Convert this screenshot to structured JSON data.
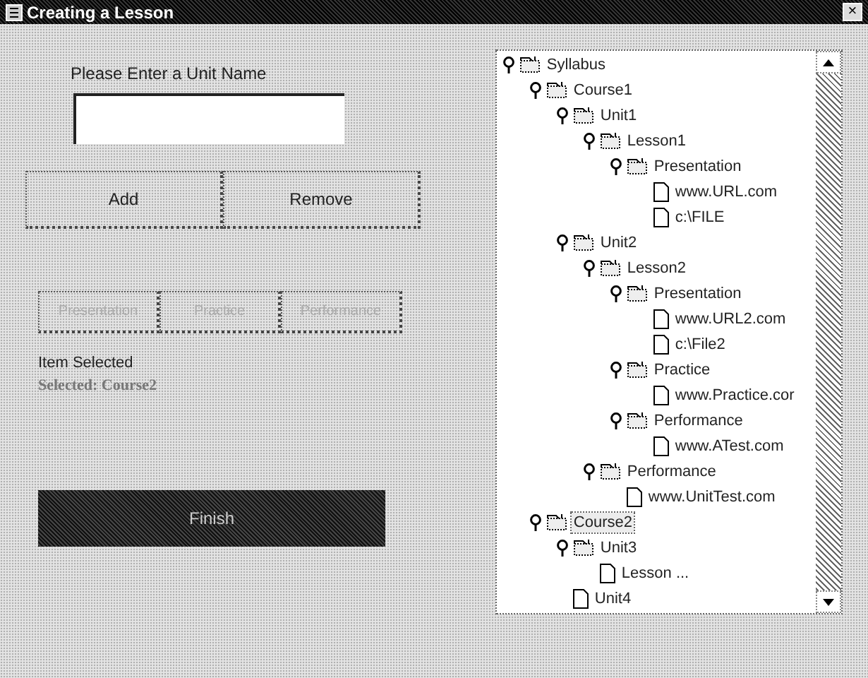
{
  "window": {
    "title": "Creating a Lesson",
    "close": "×"
  },
  "unit_name": {
    "label": "Please Enter a Unit Name"
  },
  "buttons": [
    {
      "label": "Add",
      "disabled": false
    },
    {
      "label": "Remove",
      "disabled": false
    }
  ],
  "activity_buttons": [
    {
      "label": "Presentation",
      "disabled": true
    },
    {
      "label": "Practice",
      "disabled": true
    },
    {
      "label": "Performance",
      "disabled": true
    }
  ],
  "status": {
    "title": "Item Selected",
    "value": "Selected: Course2"
  },
  "finish_button": {
    "label": "Finish"
  },
  "tree": [
    {
      "label": "Syllabus",
      "kind": "folder",
      "expanded": true,
      "selected": false,
      "children": [
        {
          "label": "Course1",
          "kind": "folder",
          "expanded": true,
          "selected": false,
          "children": [
            {
              "label": "Unit1",
              "kind": "folder",
              "expanded": true,
              "selected": false,
              "children": [
                {
                  "label": "Lesson1",
                  "kind": "folder",
                  "expanded": true,
                  "selected": false,
                  "children": [
                    {
                      "label": "Presentation",
                      "kind": "folder",
                      "expanded": true,
                      "selected": false,
                      "children": [
                        {
                          "label": "www.URL.com",
                          "kind": "file",
                          "selected": false
                        },
                        {
                          "label": "c:\\FILE",
                          "kind": "file",
                          "selected": false
                        }
                      ]
                    }
                  ]
                }
              ]
            },
            {
              "label": "Unit2",
              "kind": "folder",
              "expanded": true,
              "selected": false,
              "children": [
                {
                  "label": "Lesson2",
                  "kind": "folder",
                  "expanded": true,
                  "selected": false,
                  "children": [
                    {
                      "label": "Presentation",
                      "kind": "folder",
                      "expanded": true,
                      "selected": false,
                      "children": [
                        {
                          "label": "www.URL2.com",
                          "kind": "file",
                          "selected": false
                        },
                        {
                          "label": "c:\\File2",
                          "kind": "file",
                          "selected": false
                        }
                      ]
                    },
                    {
                      "label": "Practice",
                      "kind": "folder",
                      "expanded": true,
                      "selected": false,
                      "children": [
                        {
                          "label": "www.Practice.cor",
                          "kind": "file",
                          "selected": false
                        }
                      ]
                    },
                    {
                      "label": "Performance",
                      "kind": "folder",
                      "expanded": true,
                      "selected": false,
                      "children": [
                        {
                          "label": "www.ATest.com",
                          "kind": "file",
                          "selected": false
                        }
                      ]
                    }
                  ]
                },
                {
                  "label": "Performance",
                  "kind": "folder",
                  "expanded": true,
                  "selected": false,
                  "children": [
                    {
                      "label": "www.UnitTest.com",
                      "kind": "file",
                      "selected": false
                    }
                  ]
                }
              ]
            }
          ]
        },
        {
          "label": "Course2",
          "kind": "folder",
          "expanded": true,
          "selected": true,
          "children": [
            {
              "label": "Unit3",
              "kind": "folder",
              "expanded": true,
              "selected": false,
              "children": [
                {
                  "label": "Lesson ...",
                  "kind": "file",
                  "selected": false
                }
              ]
            },
            {
              "label": "Unit4",
              "kind": "file",
              "selected": false
            }
          ]
        }
      ]
    }
  ]
}
